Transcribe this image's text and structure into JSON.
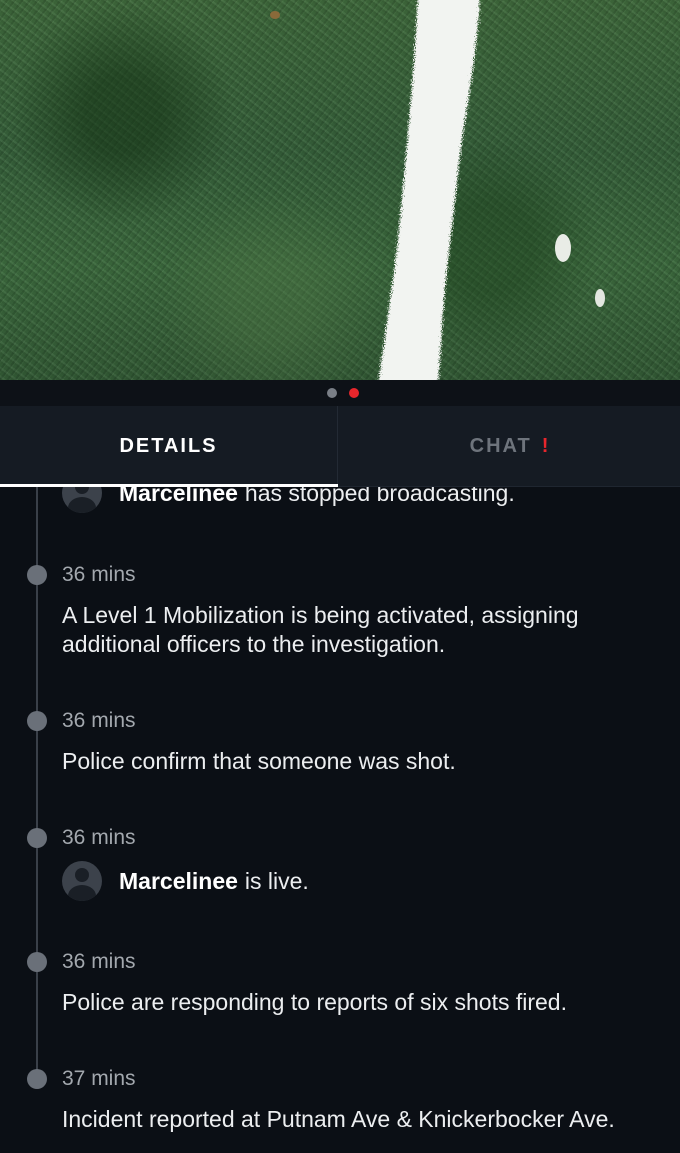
{
  "media": {
    "description_icon": "video-preview"
  },
  "pager": {
    "count": 2,
    "active_index": 1,
    "active_color": "#e8262c",
    "inactive_color": "#7a7f87"
  },
  "tabs": {
    "details_label": "DETAILS",
    "chat_label": "CHAT",
    "chat_alert": "!"
  },
  "feed": {
    "entries": [
      {
        "type": "broadcast",
        "user": "Marcelinee",
        "message": "has stopped broadcasting."
      },
      {
        "type": "update",
        "time": "36 mins",
        "text": "A Level 1 Mobilization is being activated, assigning additional officers to the investigation."
      },
      {
        "type": "update",
        "time": "36 mins",
        "text": "Police confirm that someone was shot."
      },
      {
        "type": "broadcast",
        "time": "36 mins",
        "user": "Marcelinee",
        "message": "is live."
      },
      {
        "type": "update",
        "time": "36 mins",
        "text": "Police are responding to reports of six shots fired."
      },
      {
        "type": "update",
        "time": "37 mins",
        "text": "Incident reported at Putnam Ave & Knickerbocker Ave."
      }
    ]
  }
}
